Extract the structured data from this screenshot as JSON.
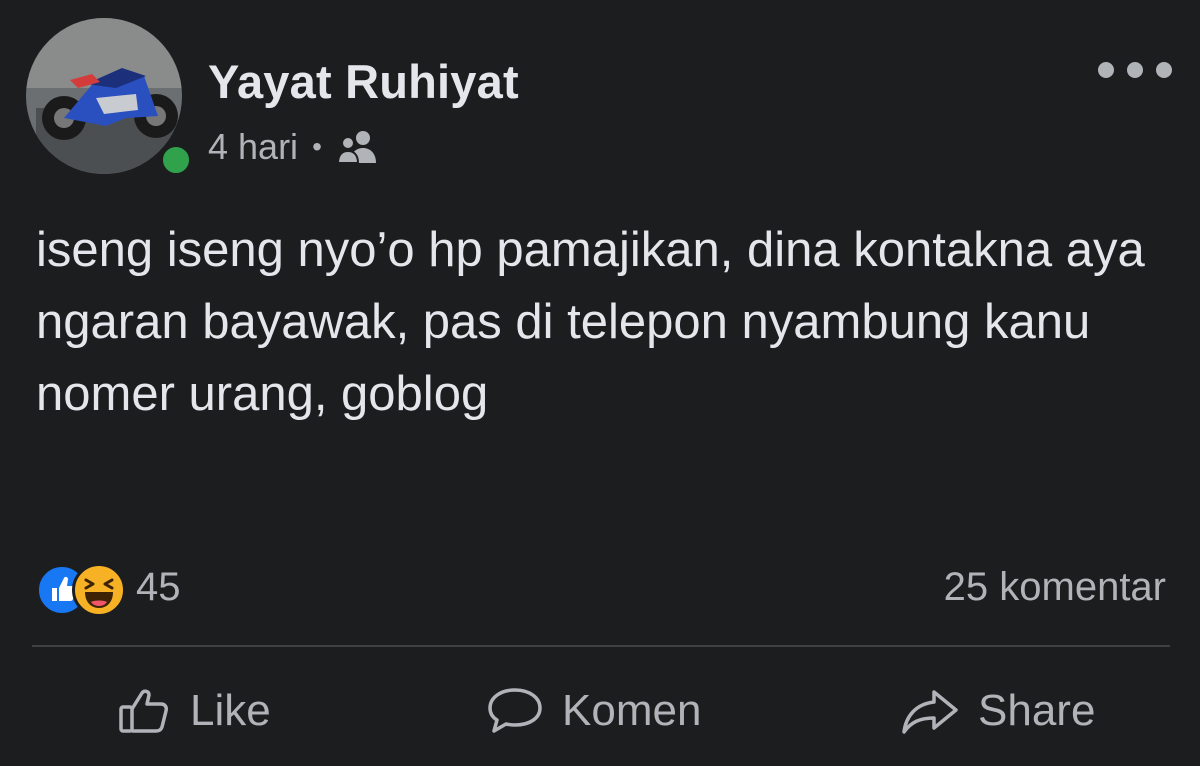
{
  "post": {
    "author": {
      "name": "Yayat Ruhiyat",
      "online": true
    },
    "meta": {
      "time": "4 hari",
      "separator": "•",
      "audience_icon": "friends-icon"
    },
    "text": "iseng iseng nyo’o hp pamajikan, dina kontakna aya ngaran bayawak, pas di telepon nyambung kanu nomer urang, goblog",
    "reactions": {
      "icons": [
        "like-reaction-icon",
        "haha-reaction-icon"
      ],
      "count": "45"
    },
    "comments": {
      "count_label": "25 komentar"
    },
    "actions": {
      "like": "Like",
      "comment": "Komen",
      "share": "Share"
    }
  },
  "colors": {
    "background": "#1c1d1f",
    "primary_text": "#e4e6eb",
    "secondary_text": "#b0b3b8",
    "online": "#31a24c",
    "like_blue": "#1877f2",
    "haha_yellow": "#f7b125"
  }
}
